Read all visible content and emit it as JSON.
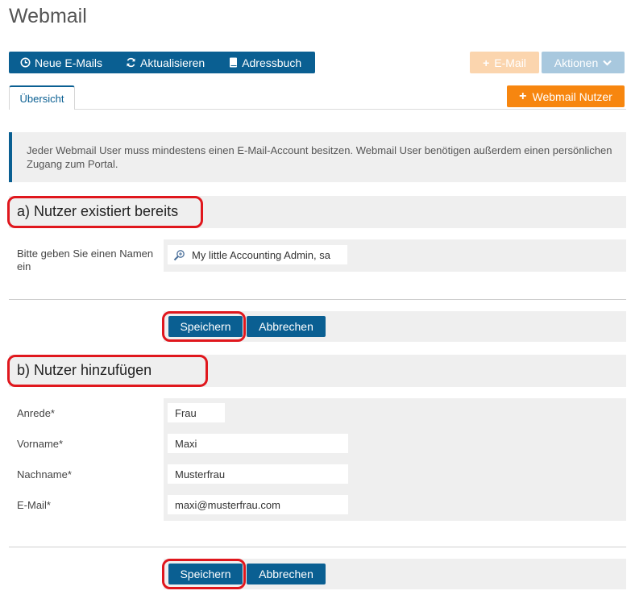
{
  "page": {
    "title": "Webmail"
  },
  "toolbar": {
    "new_mails": "Neue E-Mails",
    "refresh": "Aktualisieren",
    "address_book": "Adressbuch",
    "email": "E-Mail",
    "actions": "Aktionen"
  },
  "tabs": {
    "overview": "Übersicht"
  },
  "add_user_label": "Webmail Nutzer",
  "info": {
    "text": "Jeder Webmail User muss mindestens einen E-Mail-Account besitzen. Webmail User benötigen außerdem einen persönlichen Zugang zum Portal."
  },
  "section_a": {
    "title": "a) Nutzer existiert bereits",
    "name_label": "Bitte geben Sie einen Namen ein",
    "name_value": "My little Accounting Admin, sa"
  },
  "section_b": {
    "title": "b) Nutzer hinzufügen",
    "fields": [
      {
        "label": "Anrede*",
        "value": "Frau"
      },
      {
        "label": "Vorname*",
        "value": "Maxi"
      },
      {
        "label": "Nachname*",
        "value": "Musterfrau"
      },
      {
        "label": "E-Mail*",
        "value": "maxi@musterfrau.com"
      }
    ]
  },
  "buttons": {
    "save": "Speichern",
    "cancel": "Abbrechen"
  },
  "colors": {
    "primary": "#0a5f92",
    "orange": "#f7860f",
    "highlight_red": "#e0171d"
  }
}
